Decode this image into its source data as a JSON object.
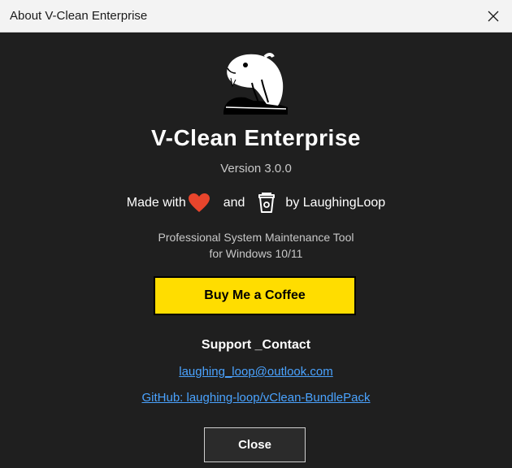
{
  "window": {
    "title": "About V-Clean Enterprise",
    "close_icon": "close-icon"
  },
  "about": {
    "logo_icon": "beaver-logo-icon",
    "app_name": "V-Clean Enterprise",
    "version": "Version 3.0.0",
    "made_with": "Made with",
    "heart_icon": "heart-icon",
    "and": "and",
    "coffee_icon": "coffee-cup-icon",
    "by": "by LaughingLoop",
    "description_line1": "Professional System Maintenance Tool",
    "description_line2": "for Windows 10/11",
    "buy_button": "Buy Me a Coffee",
    "accent_color": "#ffdd00",
    "heart_color": "#e8452c"
  },
  "support": {
    "title": "Support _Contact",
    "email": "laughing_loop@outlook.com",
    "github": "GitHub: laughing-loop/vClean-BundlePack",
    "link_color": "#4aa3ff"
  },
  "footer": {
    "close_button": "Close"
  }
}
